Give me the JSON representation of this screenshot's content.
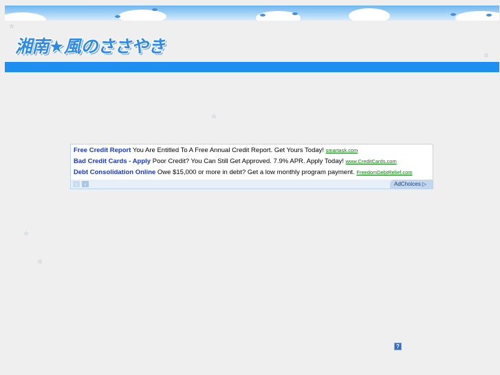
{
  "header": {
    "title": "湘南★風のささやき",
    "star_glyph": "☆"
  },
  "ads": {
    "items": [
      {
        "headline": "Free Credit Report",
        "body": "You Are Entitled To A Free Annual Credit Report. Get Yours Today!",
        "url": "smartask.com"
      },
      {
        "headline": "Bad Credit Cards - Apply",
        "body": "Poor Credit? You Can Still Get Approved. 7.9% APR. Apply Today!",
        "url": "www.CreditCards.com"
      },
      {
        "headline": "Debt Consolidation Online",
        "body": "Owe $15,000 or more in debt? Get a low monthly program payment.",
        "url": "FreedomDebtRelief.com"
      }
    ],
    "prev_glyph": "‹",
    "next_glyph": "›",
    "adchoices_label": "AdChoices ▷"
  },
  "help_glyph": "?",
  "colors": {
    "title": "#2d8ae6",
    "header_bar": "#1e8ef0",
    "page_bg": "#efefef",
    "ad_link": "#1a35c6",
    "ad_url": "#008000"
  }
}
